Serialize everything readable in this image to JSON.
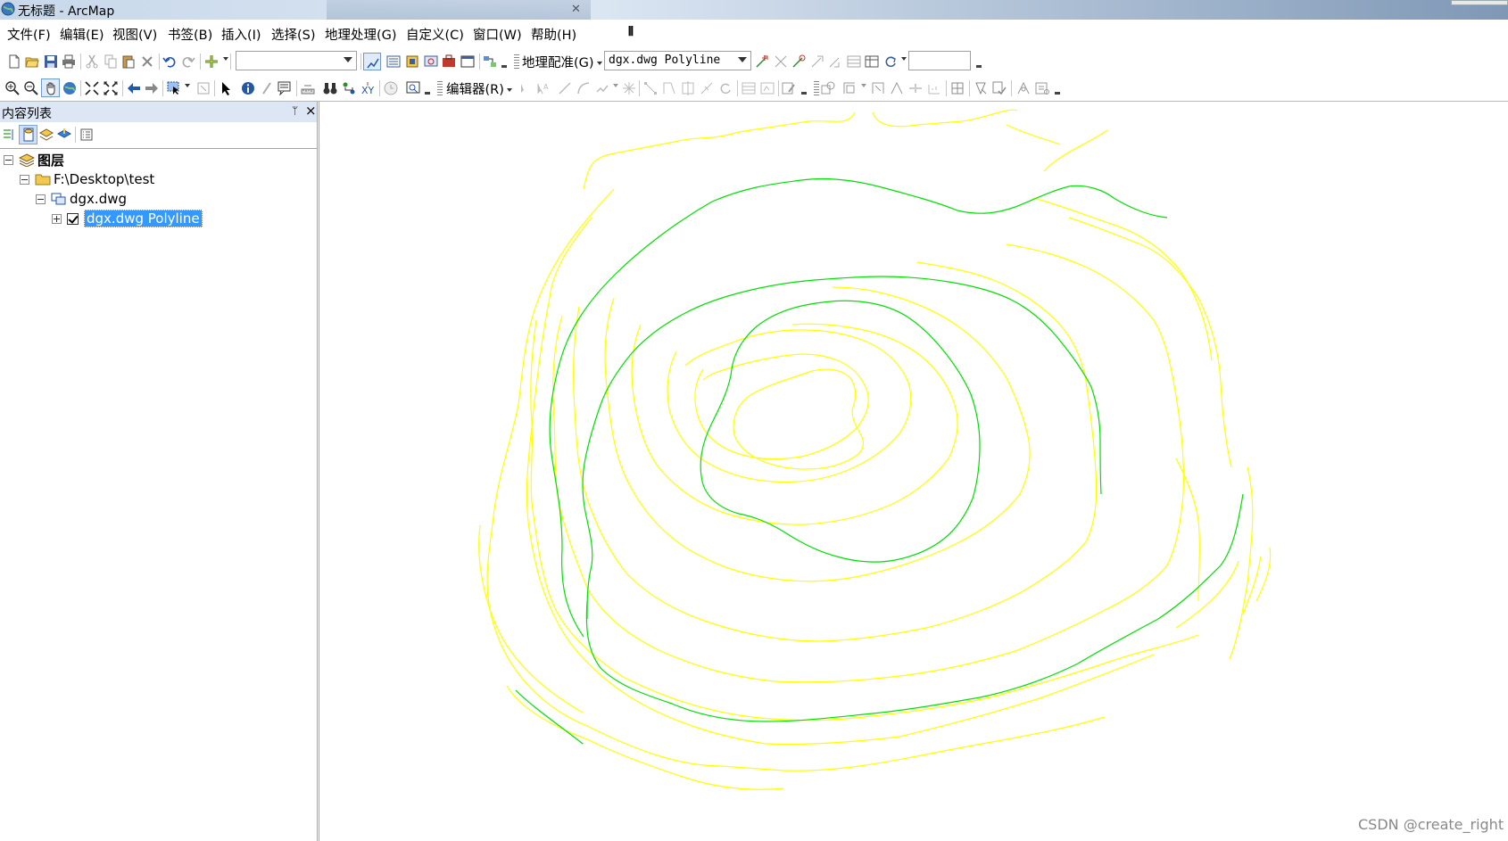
{
  "window": {
    "title": "无标题 - ArcMap"
  },
  "menu": [
    "文件(F)",
    "编辑(E)",
    "视图(V)",
    "书签(B)",
    "插入(I)",
    "选择(S)",
    "地理处理(G)",
    "自定义(C)",
    "窗口(W)",
    "帮助(H)"
  ],
  "toolbar1": {
    "scale_combo_value": "",
    "georef_label": "地理配准(G)",
    "georef_layer_value": "dgx.dwg Polyline",
    "georef_text_value": ""
  },
  "toolbar2": {
    "editor_label": "编辑器(R)"
  },
  "toc": {
    "title": "内容列表",
    "pin": "ᛘ",
    "close": "×",
    "tree": {
      "root": "图层",
      "folder": "F:\\Desktop\\test",
      "dataset": "dgx.dwg",
      "layer": "dgx.dwg Polyline",
      "layer_checked": true
    }
  },
  "map": {
    "contour_colors": {
      "regular": "#ffff00",
      "index": "#00e000"
    }
  },
  "watermark": "CSDN @create_right"
}
